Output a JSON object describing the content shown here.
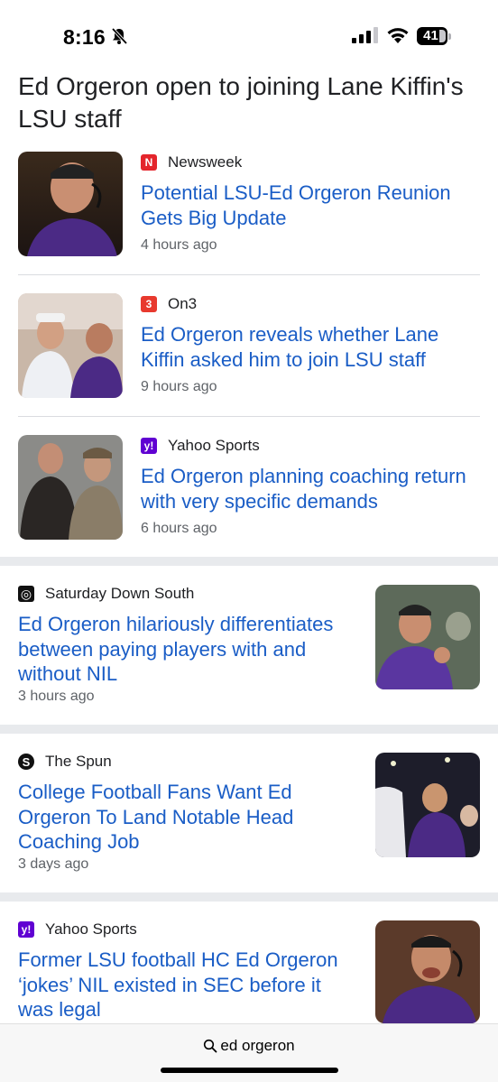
{
  "status_bar": {
    "time": "8:16",
    "battery": "41"
  },
  "story": {
    "title": "Ed Orgeron open to joining Lane Kiffin's LSU staff"
  },
  "group_articles": [
    {
      "source": "Newsweek",
      "source_logo": "N",
      "source_color": "#e4252c",
      "headline": "Potential LSU-Ed Orgeron Reunion Gets Big Update",
      "time": "4 hours ago"
    },
    {
      "source": "On3",
      "source_logo": "3",
      "source_color": "#e8392e",
      "headline": "Ed Orgeron reveals whether Lane Kiffin asked him to join LSU staff",
      "time": "9 hours ago"
    },
    {
      "source": "Yahoo Sports",
      "source_logo": "y!",
      "source_color": "#6001d2",
      "headline": "Ed Orgeron planning coaching return with very specific demands",
      "time": "6 hours ago"
    }
  ],
  "cards": [
    {
      "source": "Saturday Down South",
      "source_logo": "◎",
      "source_color": "#111111",
      "headline": "Ed Orgeron hilariously differentiates between paying players with and without NIL",
      "time": "3 hours ago"
    },
    {
      "source": "The Spun",
      "source_logo": "S",
      "source_color": "#111111",
      "headline": "College Football Fans Want Ed Orgeron To Land Notable Head Coaching Job",
      "time": "3 days ago"
    },
    {
      "source": "Yahoo Sports",
      "source_logo": "y!",
      "source_color": "#6001d2",
      "headline": "Former LSU football HC Ed Orgeron ‘jokes’ NIL existed in SEC before it was legal",
      "time": ""
    }
  ],
  "bottom_bar": {
    "search_query": "ed orgeron"
  },
  "colors": {
    "headline_link": "#1a5dc6",
    "secondary_text": "#5f6368",
    "divider": "#dadce0",
    "section_separator": "#e8eaed",
    "lsu_purple": "#4b2a85"
  }
}
